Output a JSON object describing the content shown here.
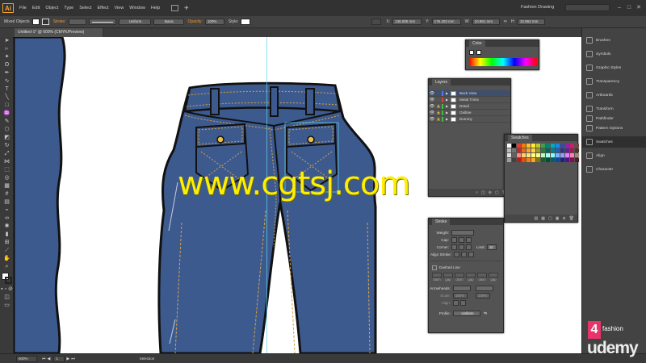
{
  "app": {
    "logo": "Ai",
    "workspace": "Fashion Drawing"
  },
  "menu": [
    "File",
    "Edit",
    "Object",
    "Type",
    "Select",
    "Effect",
    "View",
    "Window",
    "Help"
  ],
  "control": {
    "selection": "Mixed Objects",
    "stroke_label": "Stroke:",
    "stroke_profile": "Uniform",
    "brush": "Basic",
    "opacity_label": "Opacity:",
    "opacity": "100%",
    "style_label": "Style:",
    "x": "136.005 mm",
    "y": "176.403 mm",
    "w": "10.961 mm",
    "h": "10.962 mm"
  },
  "document": {
    "tab": "Untitled-1* @ 600% (CMYK/Preview)"
  },
  "status": {
    "zoom": "600%",
    "page": "1",
    "tool": "Selection"
  },
  "dock": [
    "Brushes",
    "Symbols",
    "Graphic Styles",
    "Transparency",
    "Artboards",
    "Transform",
    "Pathfinder",
    "Pattern Options",
    "Swatches",
    "Align",
    "Character"
  ],
  "color_panel": {
    "title": "Color"
  },
  "layers_panel": {
    "title": "Layers",
    "layers": [
      {
        "name": "Back View",
        "color": "#4f7cff",
        "selected": true
      },
      {
        "name": "Metal Trims",
        "color": "#e04040",
        "selected": false
      },
      {
        "name": "Detail",
        "color": "#3fbf3f",
        "selected": false
      },
      {
        "name": "Outline",
        "color": "#3fbf3f",
        "selected": false
      },
      {
        "name": "Dummy",
        "color": "#3fbf3f",
        "selected": false
      }
    ]
  },
  "swatches_panel": {
    "title": "Swatches"
  },
  "stroke_panel": {
    "title": "Stroke",
    "weight_label": "Weight:",
    "cap_label": "Cap:",
    "corner_label": "Corner:",
    "limit_label": "Limit:",
    "limit": "10",
    "align_label": "Align Stroke:",
    "dashed_label": "Dashed Line",
    "dash": "dash",
    "gap": "gap",
    "arrowheads_label": "Arrowheads:",
    "scale_label": "Scale:",
    "scale1": "100%",
    "scale2": "100%",
    "align2_label": "Align:",
    "profile_label": "Profile:",
    "profile": "Uniform"
  },
  "watermark": {
    "text": "www.cgtsj.com"
  },
  "brand": {
    "small": "illustrator",
    "logo": "4",
    "fashion": "fashion",
    "udemy": "udemy"
  },
  "colors": {
    "denim": "#3d5a8f",
    "stitch": "#d9a23c",
    "outline": "#111111",
    "ui_dark": "#323232"
  }
}
